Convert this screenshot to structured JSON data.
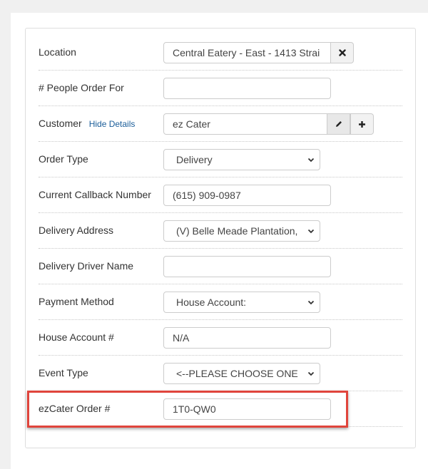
{
  "form": {
    "location": {
      "label": "Location",
      "value": "Central Eatery - East - 1413 Strai"
    },
    "people": {
      "label": "# People Order For",
      "value": ""
    },
    "customer": {
      "label": "Customer",
      "link": "Hide Details",
      "value": "ez Cater"
    },
    "order_type": {
      "label": "Order Type",
      "value": "Delivery"
    },
    "callback": {
      "label": "Current Callback Number",
      "value": "(615) 909-0987"
    },
    "delivery_address": {
      "label": "Delivery Address",
      "value": "(V) Belle Meade Plantation,"
    },
    "driver": {
      "label": "Delivery Driver Name",
      "value": ""
    },
    "payment": {
      "label": "Payment Method",
      "value": "House Account:"
    },
    "house_account": {
      "label": "House Account #",
      "value": "N/A"
    },
    "event_type": {
      "label": "Event Type",
      "value": "<--PLEASE CHOOSE ONE"
    },
    "ezcater": {
      "label": "ezCater Order #",
      "value": "1T0-QW0"
    }
  },
  "colors": {
    "highlight": "#e0453c",
    "link": "#1a5d99"
  },
  "icons": {
    "clear": "close-icon",
    "edit": "pencil-icon",
    "add": "plus-icon",
    "select": "chevron-down-icon"
  }
}
